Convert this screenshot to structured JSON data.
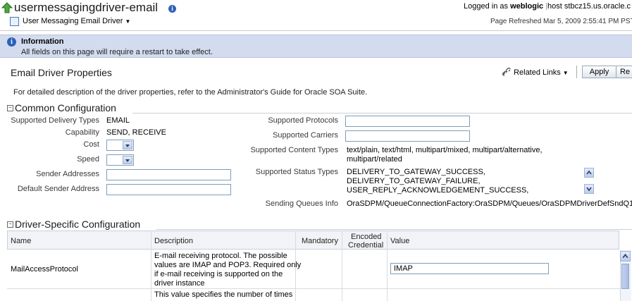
{
  "header": {
    "title": "usermessagingdriver-email",
    "target_menu": "User Messaging Email Driver",
    "logged_in_prefix": "Logged in as",
    "user": "weblogic",
    "host_label": "host stbcz15.us.oracle.c",
    "page_refreshed": "Page Refreshed Mar 5, 2009 2:55:41 PM PST"
  },
  "info": {
    "title": "Information",
    "message": "All fields on this page will require a restart to take effect."
  },
  "page": {
    "title": "Email Driver Properties",
    "related_links": "Related Links",
    "apply": "Apply",
    "revert": "Re",
    "description": "For detailed description of the driver properties, refer to the Administrator's Guide for Oracle SOA Suite."
  },
  "common": {
    "section_title": "Common Configuration",
    "supported_delivery_types_label": "Supported Delivery Types",
    "supported_delivery_types": "EMAIL",
    "capability_label": "Capability",
    "capability": "SEND, RECEIVE",
    "cost_label": "Cost",
    "speed_label": "Speed",
    "sender_addresses_label": "Sender Addresses",
    "default_sender_address_label": "Default Sender Address",
    "supported_protocols_label": "Supported Protocols",
    "supported_carriers_label": "Supported Carriers",
    "supported_content_types_label": "Supported Content Types",
    "supported_content_types_line1": "text/plain, text/html, multipart/mixed, multipart/alternative,",
    "supported_content_types_line2": "multipart/related",
    "supported_status_types_label": "Supported Status Types",
    "status_types": [
      "DELIVERY_TO_GATEWAY_SUCCESS,",
      "DELIVERY_TO_GATEWAY_FAILURE,",
      "USER_REPLY_ACKNOWLEDGEMENT_SUCCESS,"
    ],
    "sending_queues_info_label": "Sending Queues Info",
    "sending_queues_info": "OraSDPM/QueueConnectionFactory:OraSDPM/Queues/OraSDPMDriverDefSndQ1"
  },
  "driver_specific": {
    "section_title": "Driver-Specific Configuration",
    "columns": [
      "Name",
      "Description",
      "Mandatory",
      "Encoded",
      "Credential",
      "Value"
    ],
    "rows": [
      {
        "name": "MailAccessProtocol",
        "description_lines": [
          "E-mail receiving protocol. The possible",
          "values are IMAP and POP3. Required only",
          "if e-mail receiving is supported on the",
          "driver instance"
        ],
        "value": "IMAP"
      },
      {
        "name": "",
        "description_lines": [
          "This value specifies the number of times"
        ],
        "value": ""
      }
    ]
  }
}
